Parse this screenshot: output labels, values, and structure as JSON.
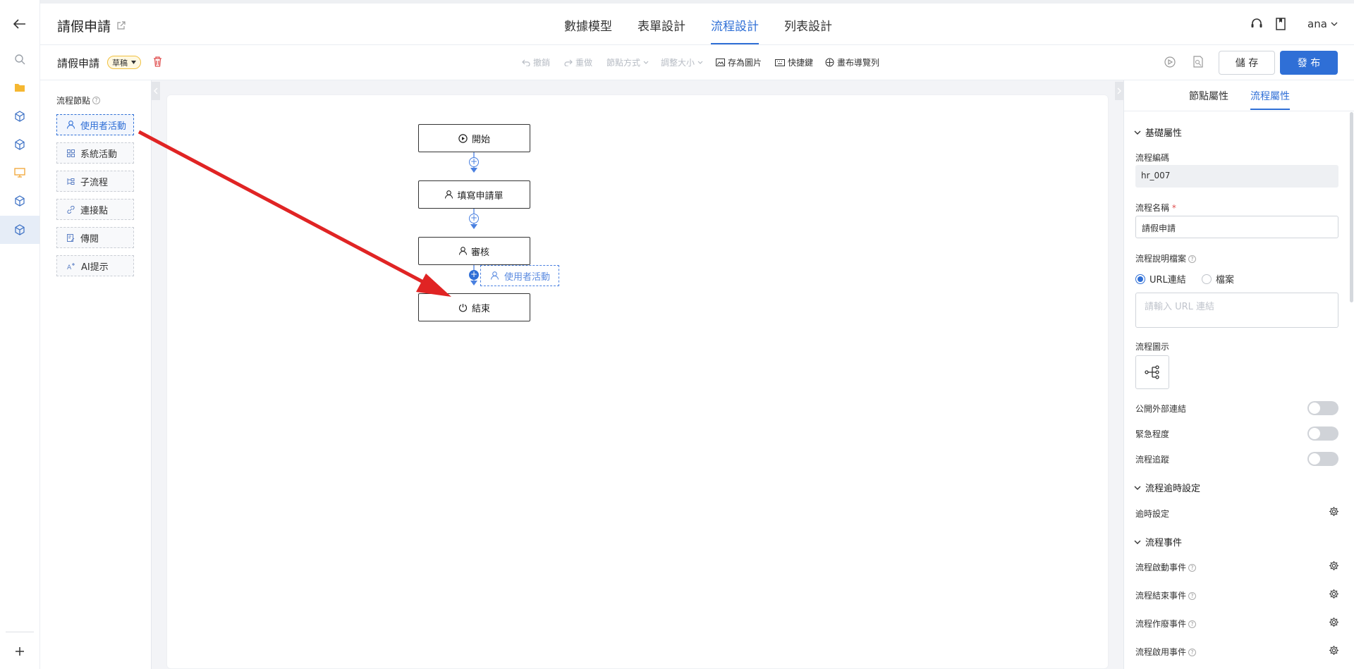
{
  "header": {
    "app_title": "請假申請",
    "tabs": [
      "數據模型",
      "表單設計",
      "流程設計",
      "列表設計"
    ],
    "user": "ana"
  },
  "toolbar": {
    "form_name": "請假申請",
    "status": "草稿",
    "undo": "撤銷",
    "redo": "重做",
    "layout": "節點方式",
    "resize": "調整大小",
    "save_image": "存為圖片",
    "shortcuts": "快捷鍵",
    "canvas_nav": "畫布導覽列",
    "save": "儲 存",
    "publish": "發 布"
  },
  "node_panel": {
    "title": "流程節點",
    "items": [
      "使用者活動",
      "系統活動",
      "子流程",
      "連接點",
      "傳閱",
      "AI提示"
    ]
  },
  "flow": {
    "nodes": [
      "開始",
      "填寫申請單",
      "審核",
      "結束"
    ],
    "drag_preview": "使用者活動"
  },
  "props": {
    "tabs": [
      "節點屬性",
      "流程屬性"
    ],
    "section_basic": "基礎屬性",
    "code_label": "流程編碼",
    "code_value": "hr_007",
    "name_label": "流程名稱",
    "name_value": "請假申請",
    "doc_label": "流程說明檔案",
    "radio_url": "URL連結",
    "radio_file": "檔案",
    "url_placeholder": "請輸入 URL 連結",
    "icon_label": "流程圖示",
    "public_link": "公開外部連結",
    "urgency": "緊急程度",
    "tracking": "流程追蹤",
    "section_timeout": "流程逾時設定",
    "timeout_setting": "逾時設定",
    "section_events": "流程事件",
    "event_start": "流程啟動事件",
    "event_end": "流程結束事件",
    "event_void": "流程作廢事件",
    "event_enable": "流程啟用事件"
  },
  "colors": {
    "accent": "#2f6fd6",
    "arrow": "#e02424",
    "danger": "#e05050"
  }
}
